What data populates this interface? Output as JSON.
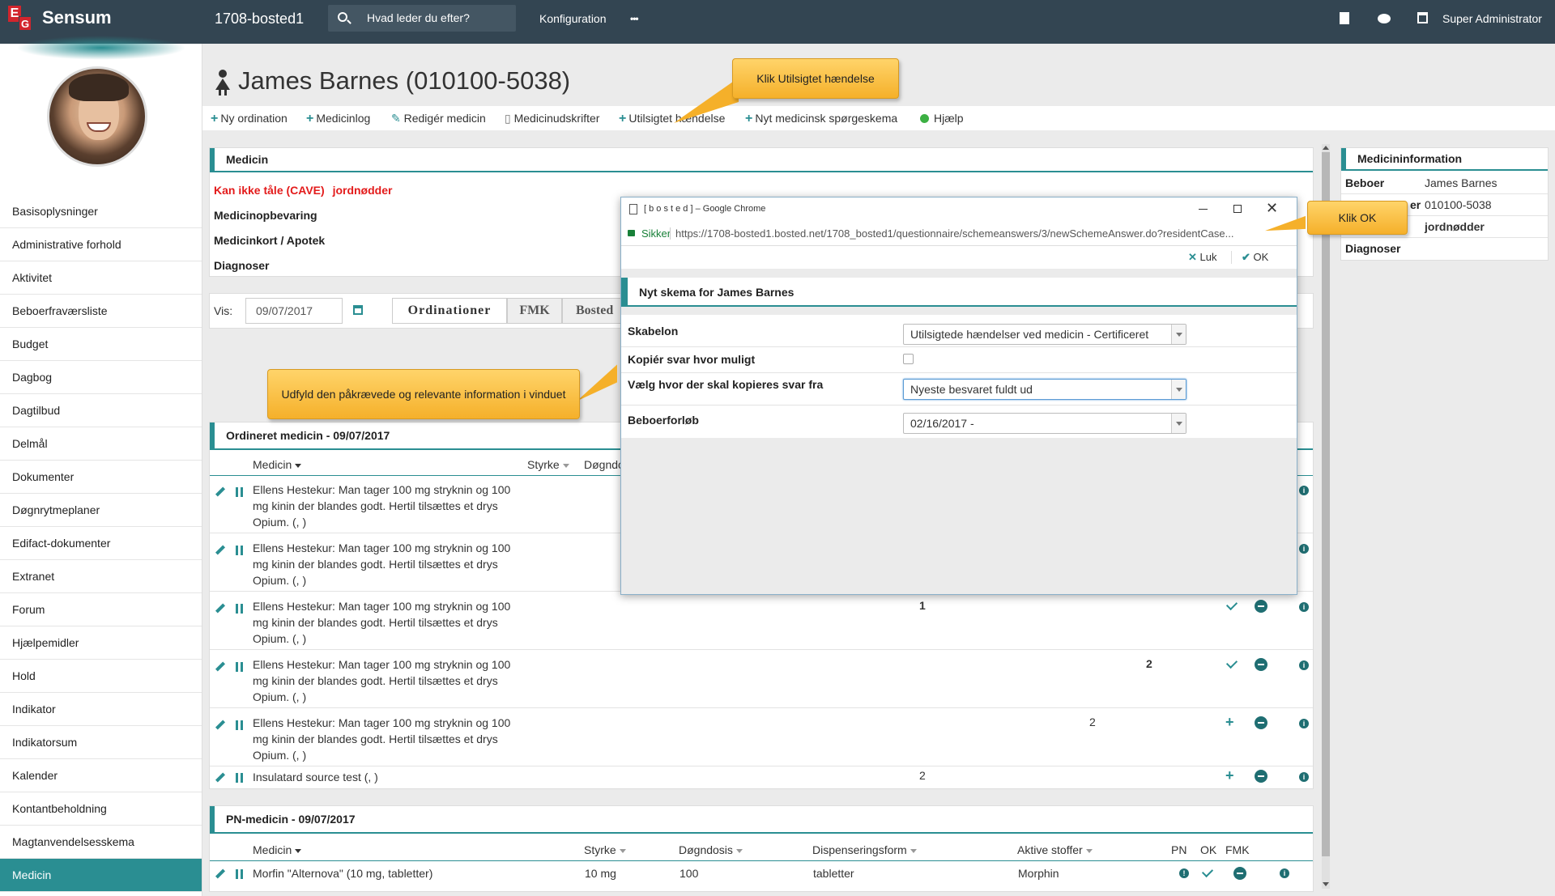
{
  "topbar": {
    "logo_e": "E",
    "logo_g": "G",
    "brand": "Sensum",
    "instance": "1708-bosted1",
    "search_placeholder": "Hvad leder du efter?",
    "config": "Konfiguration",
    "more": "•••",
    "user": "Super Administrator"
  },
  "sidebar": {
    "items": [
      "Basisoplysninger",
      "Administrative forhold",
      "Aktivitet",
      "Beboerfraværsliste",
      "Budget",
      "Dagbog",
      "Dagtilbud",
      "Delmål",
      "Dokumenter",
      "Døgnrytmeplaner",
      "Edifact-dokumenter",
      "Extranet",
      "Forum",
      "Hjælpemidler",
      "Hold",
      "Indikator",
      "Indikatorsum",
      "Kalender",
      "Kontantbeholdning",
      "Magtanvendelsesskema",
      "Medicin"
    ],
    "active": "Medicin"
  },
  "page": {
    "title": "James Barnes (010100-5038)"
  },
  "actions": {
    "new_ordination": "Ny ordination",
    "medicinlog": "Medicinlog",
    "edit_medicin": "Redigér medicin",
    "print": "Medicinudskrifter",
    "incident": "Utilsigtet hændelse",
    "questionnaire": "Nyt medicinsk spørgeskema",
    "help": "Hjælp"
  },
  "medicin_panel": {
    "title": "Medicin",
    "cave_label": "Kan ikke tåle (CAVE)",
    "cave_value": "jordnødder",
    "storage": "Medicinopbevaring",
    "card": "Medicinkort / Apotek",
    "diagnoses": "Diagnoser"
  },
  "filter": {
    "label": "Vis:",
    "date": "09/07/2017",
    "tabs": [
      "Ordinationer",
      "FMK",
      "Bosted"
    ]
  },
  "ordineret": {
    "title": "Ordineret medicin - 09/07/2017",
    "col_medicin": "Medicin",
    "col_styrke": "Styrke",
    "col_dogn": "Døgndo",
    "rows": [
      {
        "l1": "Ellens Hestekur: Man tager 100 mg stryknin og 100",
        "l2": "mg kinin der blandes godt. Hertil tilsættes et drys",
        "l3": "Opium. (, )",
        "v": ""
      },
      {
        "l1": "Ellens Hestekur: Man tager 100 mg stryknin og 100",
        "l2": "mg kinin der blandes godt. Hertil tilsættes et drys",
        "l3": "Opium. (, )",
        "v": ""
      },
      {
        "l1": "Ellens Hestekur: Man tager 100 mg stryknin og 100",
        "l2": "mg kinin der blandes godt. Hertil tilsættes et drys",
        "l3": "Opium. (, )",
        "v": "1"
      },
      {
        "l1": "Ellens Hestekur: Man tager 100 mg stryknin og 100",
        "l2": "mg kinin der blandes godt. Hertil tilsættes et drys",
        "l3": "Opium. (, )",
        "v": "2"
      },
      {
        "l1": "Ellens Hestekur: Man tager 100 mg stryknin og 100",
        "l2": "mg kinin der blandes godt. Hertil tilsættes et drys",
        "l3": "Opium. (, )",
        "v": "2"
      }
    ],
    "last_row": {
      "name": "Insulatard source test (, )",
      "v": "2"
    }
  },
  "pn": {
    "title": "PN-medicin - 09/07/2017",
    "cols": {
      "medicin": "Medicin",
      "styrke": "Styrke",
      "dogndosis": "Døgndosis",
      "form": "Dispenseringsform",
      "stoffer": "Aktive stoffer",
      "pn": "PN",
      "ok": "OK",
      "fmk": "FMK"
    },
    "row": {
      "name": "Morfin \"Alternova\" (10 mg, tabletter)",
      "styrke": "10 mg",
      "dosis": "100",
      "form": "tabletter",
      "stoffer": "Morphin"
    }
  },
  "right_panel": {
    "title": "Medicininformation",
    "beboer_k": "Beboer",
    "beboer_v": "James Barnes",
    "cpr_k_partial": "er",
    "cpr_v": "010100-5038",
    "cave_v": "jordnødder",
    "diag_k": "Diagnoser"
  },
  "popup": {
    "window_title": "[ b o s t e d ] – Google Chrome",
    "secure": "Sikker",
    "url": "https://1708-bosted1.bosted.net/1708_bosted1/questionnaire/schemeanswers/3/newSchemeAnswer.do?residentCase...",
    "close": "Luk",
    "ok": "OK",
    "header": "Nyt skema for James Barnes",
    "skabelon_label": "Skabelon",
    "skabelon_value": "Utilsigtede hændelser ved medicin - Certificeret",
    "copy_label": "Kopiér svar hvor muligt",
    "source_label": "Vælg hvor der skal kopieres svar fra",
    "source_value": "Nyeste besvaret fuldt ud",
    "course_label": "Beboerforløb",
    "course_value": "02/16/2017 -"
  },
  "callouts": {
    "incident": "Klik Utilsigtet hændelse",
    "ok": "Klik OK",
    "fill": "Udfyld den påkrævede og relevante information i vinduet"
  },
  "colors": {
    "accent": "#2a8e92",
    "topbar": "#334552",
    "callout": "#f5b02a",
    "cave": "#e31b1b"
  }
}
